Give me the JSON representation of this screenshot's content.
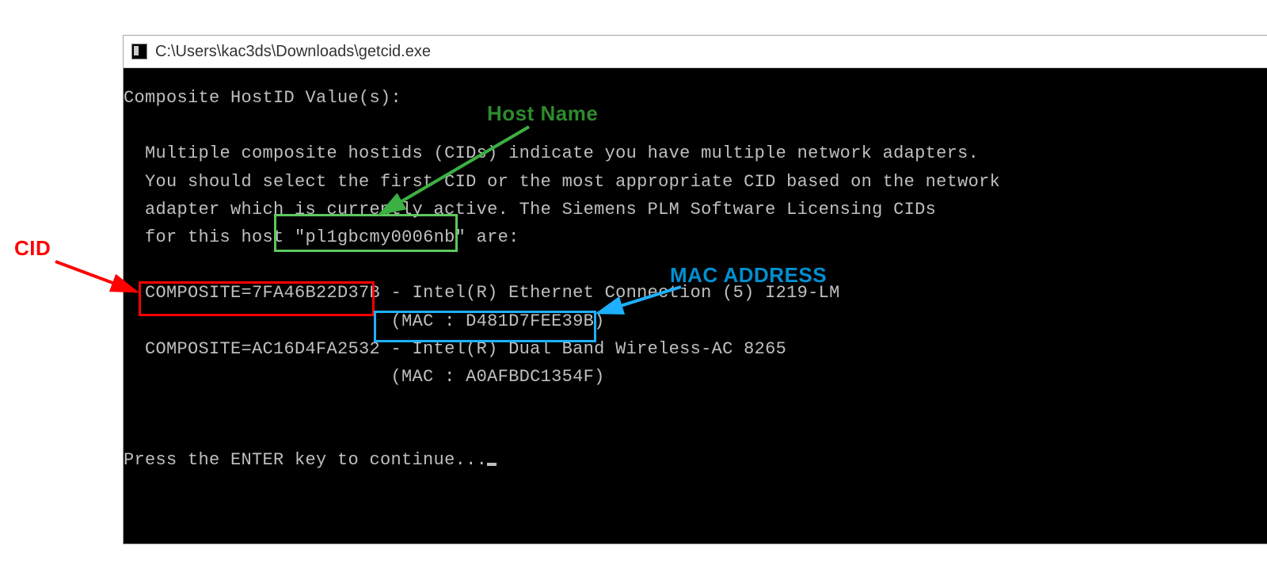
{
  "window": {
    "title": "C:\\Users\\kac3ds\\Downloads\\getcid.exe"
  },
  "terminal": {
    "header": "Composite HostID Value(s):",
    "body1": "  Multiple composite hostids (CIDs) indicate you have multiple network adapters.",
    "body2": "  You should select the first CID or the most appropriate CID based on the network",
    "body3": "  adapter which is currently active. The Siemens PLM Software Licensing CIDs",
    "body4a": "  for this host ",
    "hostname": "\"pl1gbcmy0006nb\"",
    "body4b": " are:",
    "cid1_pre": "  ",
    "cid1": "COMPOSITE=7FA46B22D37B",
    "cid1_suf": " - Intel(R) Ethernet Connection (5) I219-LM",
    "mac1_pre": "                         ",
    "mac1": "(MAC : D481D7FEE39B)",
    "cid2": "  COMPOSITE=AC16D4FA2532 - Intel(R) Dual Band Wireless-AC 8265",
    "mac2": "                         (MAC : A0AFBDC1354F)",
    "prompt": "Press the ENTER key to continue..."
  },
  "annotations": {
    "cid_label": "CID",
    "hostname_label": "Host Name",
    "mac_label": "MAC ADDRESS"
  }
}
